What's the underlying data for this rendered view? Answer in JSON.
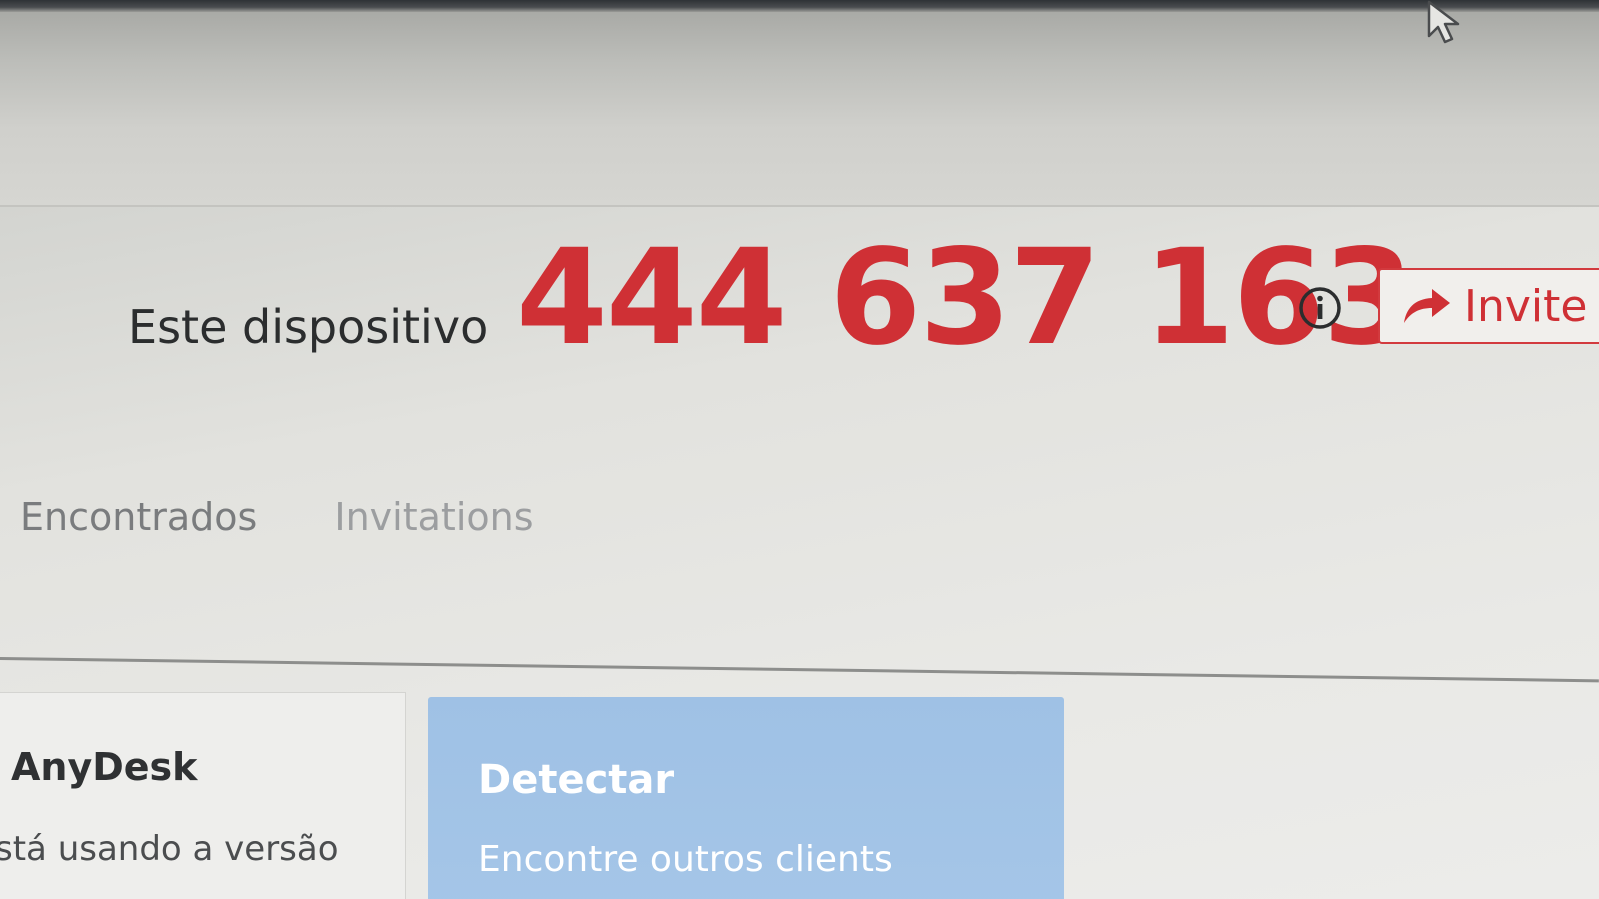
{
  "header": {
    "device_label": "Este dispositivo",
    "device_id": "444 637 163",
    "info_icon": "info-icon",
    "invite": {
      "icon": "share-arrow-icon",
      "label": "Invite"
    }
  },
  "tabs": [
    {
      "label": "Encontrados"
    },
    {
      "label": "Invitations"
    }
  ],
  "cards": {
    "anydesk": {
      "title": "AnyDesk",
      "text": "stá usando a versão"
    },
    "detect": {
      "title": "Detectar",
      "text": "Encontre outros clients"
    }
  },
  "colors": {
    "accent_red": "#cf3035",
    "detect_blue": "#a2c3e6"
  }
}
